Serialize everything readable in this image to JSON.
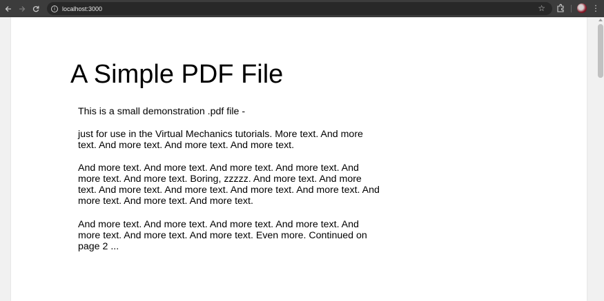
{
  "browser": {
    "url": "localhost:3000",
    "back_icon": "back-arrow-icon",
    "forward_icon": "forward-arrow-icon",
    "reload_icon": "reload-icon"
  },
  "document": {
    "title": "A Simple PDF File",
    "paragraphs": [
      "This is a small demonstration .pdf file -",
      "just for use in the Virtual Mechanics tutorials. More text. And more text. And more text. And more text. And more text.",
      "And more text. And more text. And more text. And more text. And more text. And more text. Boring, zzzzz. And more text. And more text. And more text. And more text. And more text. And more text. And more text. And more text. And more text.",
      "And more text. And more text. And more text. And more text. And more text. And more text. And more text. Even more. Continued on page 2 ..."
    ]
  }
}
